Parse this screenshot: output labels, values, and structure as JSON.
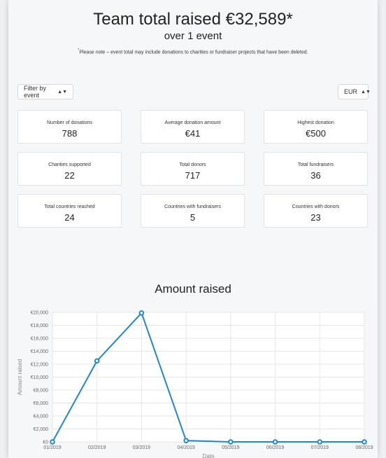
{
  "header": {
    "title": "Team total raised €32,589*",
    "subtitle": "over 1 event",
    "note_mark": "*",
    "note": "Please note – event total may include donations to charities or fundraiser projects that have been deleted."
  },
  "filters": {
    "event_label": "Filter by event",
    "currency_label": "EUR"
  },
  "stats": [
    {
      "label": "Number of donations",
      "value": "788"
    },
    {
      "label": "Average donation amount",
      "value": "€41"
    },
    {
      "label": "Highest donation",
      "value": "€500"
    },
    {
      "label": "Charities supported",
      "value": "22"
    },
    {
      "label": "Total donors",
      "value": "717"
    },
    {
      "label": "Total fundraisers",
      "value": "36"
    },
    {
      "label": "Total countries reached",
      "value": "24"
    },
    {
      "label": "Countries with fundraisers",
      "value": "5"
    },
    {
      "label": "Countries with donors",
      "value": "23"
    }
  ],
  "colors": {
    "line": "#1f86d6",
    "grid": "#e6e6e6"
  },
  "chart_data": {
    "type": "line",
    "title": "Amount raised",
    "xlabel": "Date",
    "ylabel": "Amount raised",
    "ylim": [
      0,
      20000
    ],
    "yticks": [
      "€0",
      "€2,000",
      "€4,000",
      "€6,000",
      "€8,000",
      "€10,000",
      "€12,000",
      "€14,000",
      "€16,000",
      "€18,000",
      "€20,000"
    ],
    "categories": [
      "01/2019",
      "02/2019",
      "03/2019",
      "04/2019",
      "05/2019",
      "06/2019",
      "07/2019",
      "08/2019"
    ],
    "series": [
      {
        "values": [
          0,
          12500,
          19900,
          200,
          0,
          0,
          0,
          0
        ]
      }
    ],
    "grid": true
  }
}
